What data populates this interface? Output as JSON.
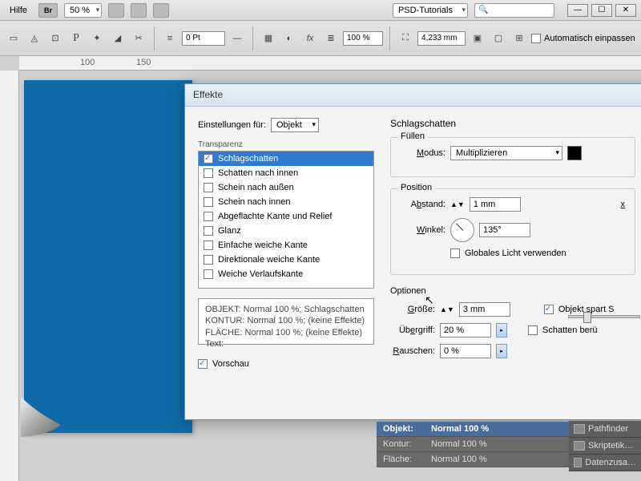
{
  "menubar": {
    "help": "Hilfe",
    "bridge": "Br",
    "zoom": "50 %",
    "psd_tutorials": "PSD-Tutorials"
  },
  "toolbar": {
    "stroke_pt": "0 Pt",
    "opacity": "100 %",
    "width_mm": "4,233 mm",
    "auto_fit": "Automatisch einpassen"
  },
  "ruler": {
    "t100": "100",
    "t150": "150"
  },
  "dialog": {
    "title": "Effekte",
    "settings_for_label": "Einstellungen für:",
    "settings_for_value": "Objekt",
    "transparency_label": "Transparenz",
    "effects": [
      {
        "label": "Schlagschatten",
        "checked": true,
        "selected": true
      },
      {
        "label": "Schatten nach innen",
        "checked": false
      },
      {
        "label": "Schein nach außen",
        "checked": false
      },
      {
        "label": "Schein nach innen",
        "checked": false
      },
      {
        "label": "Abgeflachte Kante und Relief",
        "checked": false
      },
      {
        "label": "Glanz",
        "checked": false
      },
      {
        "label": "Einfache weiche Kante",
        "checked": false
      },
      {
        "label": "Direktionale weiche Kante",
        "checked": false
      },
      {
        "label": "Weiche Verlaufskante",
        "checked": false
      }
    ],
    "summary": {
      "line1": "OBJEKT: Normal 100 %; Schlagschatten",
      "line2": "KONTUR: Normal 100 %; (keine Effekte)",
      "line3": "FLÄCHE: Normal 100 %; (keine Effekte)",
      "line4": "Text:"
    },
    "preview": "Vorschau",
    "right": {
      "heading": "Schlagschatten",
      "fill_group": "Füllen",
      "mode_label": "Modus:",
      "mode_value": "Multiplizieren",
      "position_group": "Position",
      "distance_label": "Abstand:",
      "distance_value": "1 mm",
      "angle_label": "Winkel:",
      "angle_value": "135°",
      "global_light": "Globales Licht verwenden",
      "options_group": "Optionen",
      "size_label": "Größe:",
      "size_value": "3 mm",
      "spread_label": "Übergriff:",
      "spread_value": "20 %",
      "noise_label": "Rauschen:",
      "noise_value": "0 %",
      "knockout": "Objekt spart S",
      "shadow_be": "Schatten berü"
    }
  },
  "bottom_panel": {
    "object": {
      "k": "Objekt:",
      "v": "Normal 100 %"
    },
    "kontur": {
      "k": "Kontur:",
      "v": "Normal 100 %"
    },
    "flaeche": {
      "k": "Fläche:",
      "v": "Normal 100 %"
    }
  },
  "side_tabs": {
    "pathfinder": "Pathfinder",
    "skript": "Skriptetik…",
    "daten": "Datenzusa…"
  }
}
